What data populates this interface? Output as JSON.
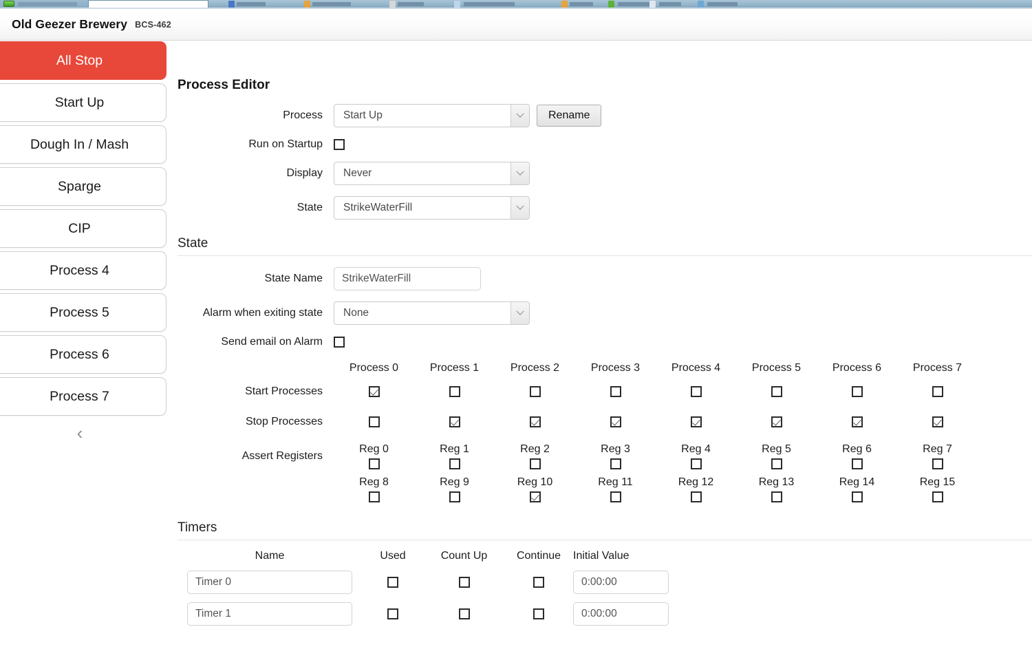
{
  "browser_chrome": {
    "visible": true
  },
  "header": {
    "brand": "Old Geezer Brewery",
    "model": "BCS-462"
  },
  "sidebar": {
    "collapse_icon": "chevron-left-icon",
    "items": [
      {
        "label": "All Stop",
        "active": true
      },
      {
        "label": "Start Up",
        "active": false
      },
      {
        "label": "Dough In / Mash",
        "active": false
      },
      {
        "label": "Sparge",
        "active": false
      },
      {
        "label": "CIP",
        "active": false
      },
      {
        "label": "Process 4",
        "active": false
      },
      {
        "label": "Process 5",
        "active": false
      },
      {
        "label": "Process 6",
        "active": false
      },
      {
        "label": "Process 7",
        "active": false
      }
    ]
  },
  "process_editor": {
    "heading": "Process Editor",
    "process_label": "Process",
    "process_value": "Start Up",
    "rename_label": "Rename",
    "run_on_startup_label": "Run on Startup",
    "run_on_startup_checked": false,
    "display_label": "Display",
    "display_value": "Never",
    "state_label": "State",
    "state_value": "StrikeWaterFill"
  },
  "state_section": {
    "heading": "State",
    "state_name_label": "State Name",
    "state_name_value": "StrikeWaterFill",
    "alarm_label": "Alarm when exiting state",
    "alarm_value": "None",
    "email_label": "Send email on Alarm",
    "email_checked": false,
    "process_columns": [
      "Process 0",
      "Process 1",
      "Process 2",
      "Process 3",
      "Process 4",
      "Process 5",
      "Process 6",
      "Process 7"
    ],
    "start_processes_label": "Start Processes",
    "start_processes": [
      true,
      false,
      false,
      false,
      false,
      false,
      false,
      false
    ],
    "stop_processes_label": "Stop Processes",
    "stop_processes": [
      false,
      true,
      true,
      true,
      true,
      true,
      true,
      true
    ],
    "assert_registers_label": "Assert Registers",
    "registers_row1": [
      "Reg 0",
      "Reg 1",
      "Reg 2",
      "Reg 3",
      "Reg 4",
      "Reg 5",
      "Reg 6",
      "Reg 7"
    ],
    "registers_row1_checked": [
      false,
      false,
      false,
      false,
      false,
      false,
      false,
      false
    ],
    "registers_row2": [
      "Reg 8",
      "Reg 9",
      "Reg 10",
      "Reg 11",
      "Reg 12",
      "Reg 13",
      "Reg 14",
      "Reg 15"
    ],
    "registers_row2_checked": [
      false,
      false,
      true,
      false,
      false,
      false,
      false,
      false
    ]
  },
  "timers": {
    "heading": "Timers",
    "columns": {
      "name": "Name",
      "used": "Used",
      "count_up": "Count Up",
      "continue": "Continue",
      "initial_value": "Initial Value"
    },
    "rows": [
      {
        "name": "Timer 0",
        "used": false,
        "count_up": false,
        "continue": false,
        "initial_value": "0:00:00"
      },
      {
        "name": "Timer 1",
        "used": false,
        "count_up": false,
        "continue": false,
        "initial_value": "0:00:00"
      }
    ]
  },
  "colors": {
    "accent_red": "#e8483a",
    "text": "#1c1c1c",
    "border": "#cfcfcf"
  }
}
